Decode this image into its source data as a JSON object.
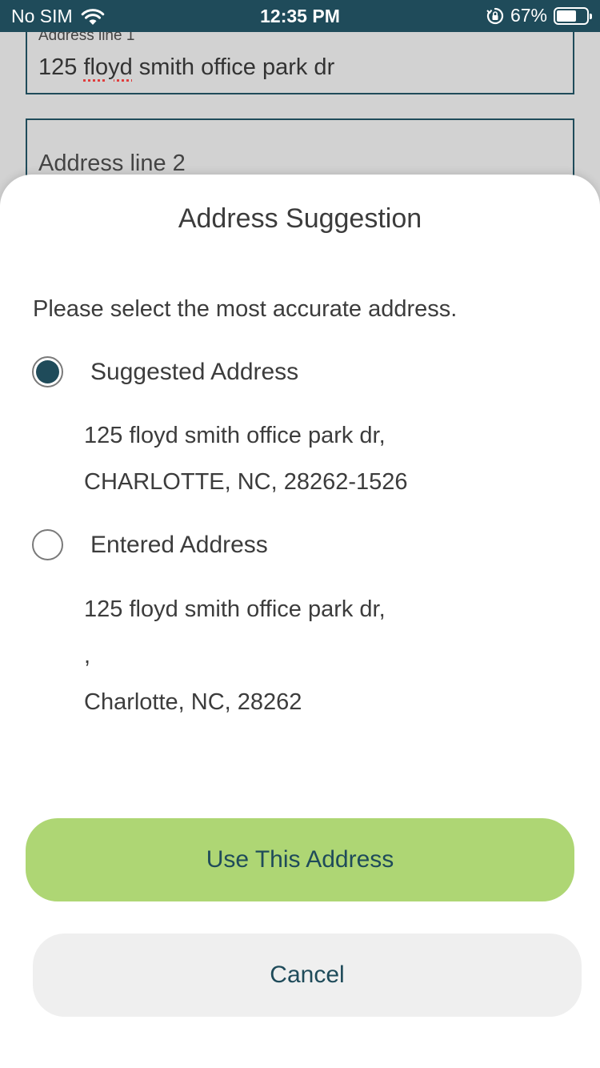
{
  "status_bar": {
    "carrier": "No SIM",
    "time": "12:35 PM",
    "battery_percent": "67%",
    "battery_level": 0.67,
    "icons": [
      "wifi-icon",
      "orientation-lock-icon",
      "battery-icon"
    ]
  },
  "background_form": {
    "address_line_1_label": "Address line 1",
    "address_line_1_value_part1": "125 ",
    "address_line_1_value_misspelled": "floyd",
    "address_line_1_value_part2": " smith office park dr",
    "address_line_2_placeholder": "Address line 2"
  },
  "sheet": {
    "title": "Address Suggestion",
    "instruction": "Please select the most accurate address.",
    "options": [
      {
        "label": "Suggested Address",
        "selected": true,
        "lines": [
          "125 floyd smith office park dr,",
          "CHARLOTTE, NC, 28262-1526"
        ]
      },
      {
        "label": "Entered Address",
        "selected": false,
        "lines": [
          "125 floyd smith office park dr,",
          ",",
          "Charlotte, NC, 28262"
        ]
      }
    ],
    "primary_button": "Use This Address",
    "secondary_button": "Cancel"
  },
  "colors": {
    "brand_dark": "#1f4b5a",
    "primary_button": "#aed674",
    "secondary_button": "#efefef"
  }
}
